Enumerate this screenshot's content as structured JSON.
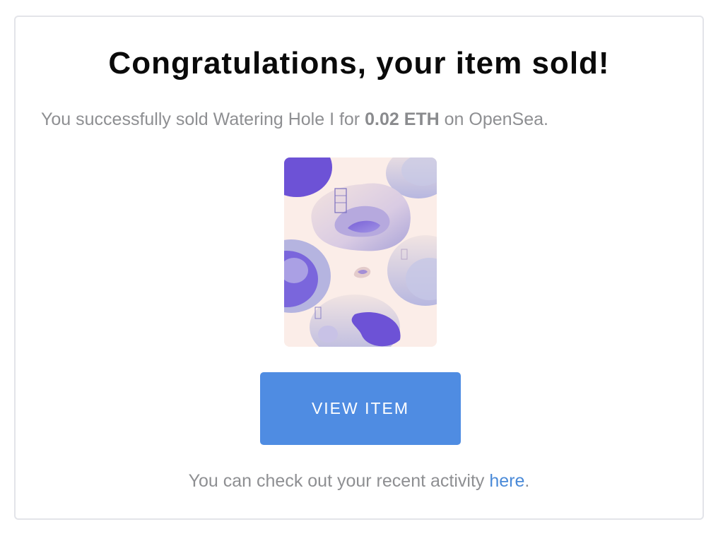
{
  "email": {
    "title": "Congratulations, your item sold!",
    "subtitle_prefix": "You successfully sold Watering Hole I for ",
    "price": "0.02 ETH",
    "subtitle_suffix": " on OpenSea.",
    "artwork_icon": "nft-artwork-image",
    "view_button_label": "VIEW ITEM",
    "footer_prefix": "You can check out your recent activity ",
    "footer_link": "here",
    "footer_suffix": "."
  },
  "colors": {
    "button": "#4f8ce2",
    "link": "#4a8ad8",
    "muted_text": "#8e8f92",
    "title_text": "#0a0a0a",
    "card_border": "#e3e4e9"
  }
}
